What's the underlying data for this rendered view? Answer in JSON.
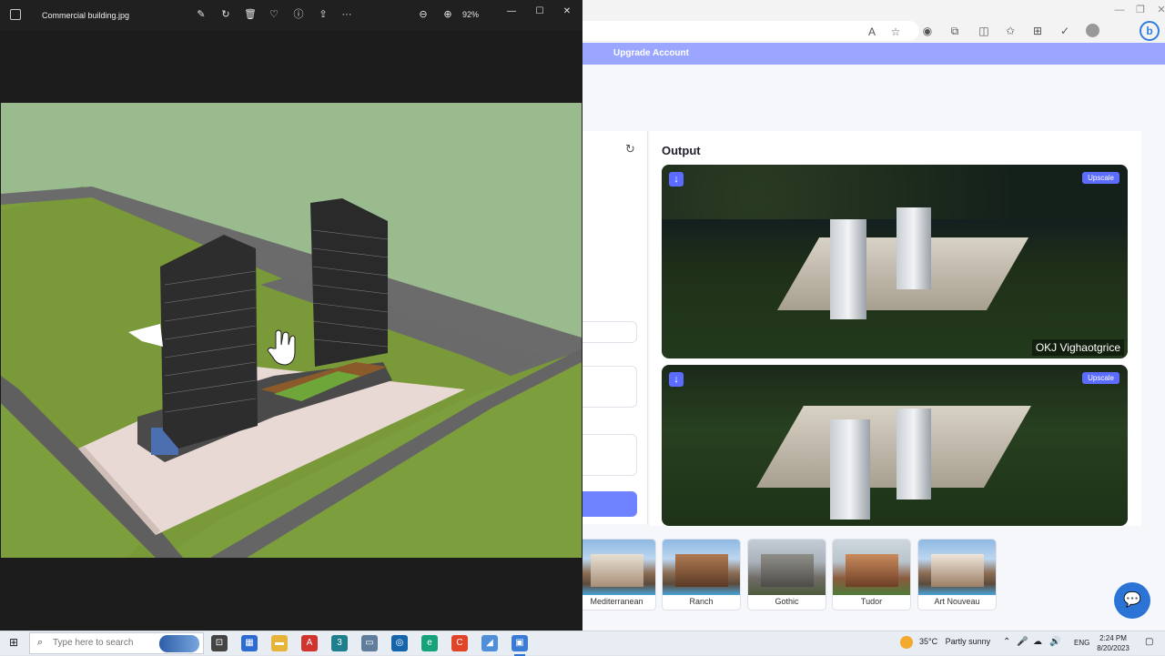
{
  "photos": {
    "file_name": "Commercial building.jpg",
    "zoom": "92%",
    "tools": {
      "edit": "✎",
      "rotate": "↻",
      "delete": "🗑",
      "favorite": "♡",
      "info": "ⓘ",
      "share": "⇪",
      "more": "···",
      "zoom_out": "⊖",
      "zoom_in": "⊕"
    },
    "window": {
      "minimize": "—",
      "maximize": "☐",
      "close": "✕"
    }
  },
  "browser": {
    "window": {
      "minimize": "—",
      "restore": "❐",
      "close": "✕"
    },
    "toolbar_icons": {
      "read_aloud": "A",
      "favorite": "☆",
      "browser_essentials": "◉",
      "extensions": "⧉",
      "split": "◫",
      "favorites": "✩",
      "collections": "⊞",
      "tracker": "✓",
      "bing": "b"
    },
    "banner": {
      "upgrade_label": "Upgrade Account"
    },
    "reset_icon": "↻",
    "output": {
      "title": "Output",
      "cards": [
        {
          "download": "↓",
          "upscale": "Upscale",
          "watermark": "OKJ Vighaotgrice"
        },
        {
          "download": "↓",
          "upscale": "Upscale"
        }
      ]
    },
    "styles": [
      {
        "label": "Mediterranean"
      },
      {
        "label": "Ranch"
      },
      {
        "label": "Gothic"
      },
      {
        "label": "Tudor"
      },
      {
        "label": "Art Nouveau"
      }
    ],
    "chat_icon": "💬"
  },
  "taskbar": {
    "start": "⊞",
    "search_placeholder": "Type here to search",
    "search_icon": "⌕",
    "apps": [
      {
        "glyph": "⊡",
        "color": "#444"
      },
      {
        "glyph": "▦",
        "color": "#2d6bd1"
      },
      {
        "glyph": "▬",
        "color": "#e7b43a"
      },
      {
        "glyph": "A",
        "color": "#d1342f"
      },
      {
        "glyph": "3",
        "color": "#1f7f8d"
      },
      {
        "glyph": "▭",
        "color": "#607d9b"
      },
      {
        "glyph": "◎",
        "color": "#1664a9"
      },
      {
        "glyph": "e",
        "color": "#17a37a"
      },
      {
        "glyph": "C",
        "color": "#e0452a"
      },
      {
        "glyph": "◢",
        "color": "#4f8fd9"
      },
      {
        "glyph": "▣",
        "color": "#3a7bd5"
      }
    ],
    "weather": {
      "temp": "35°C",
      "condition": "Partly sunny"
    },
    "tray": {
      "chevron": "⌃",
      "mic": "🎤",
      "network": "☁",
      "volume": "🔊",
      "language": "ENG"
    },
    "time": "2:24 PM",
    "date": "8/20/2023",
    "notification": "▢"
  }
}
